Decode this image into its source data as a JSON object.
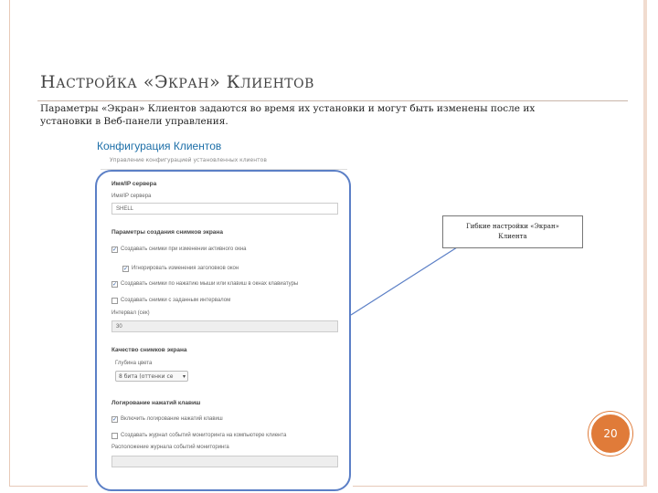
{
  "slide": {
    "title_cap1": "Н",
    "title_rest1": "АСТРОЙКА",
    "title_mid": "«Э",
    "title_mid_rest": "КРАН",
    "title_mid_end": "» К",
    "title_end": "ЛИЕНТОВ",
    "subtitle": "Параметры «Экран» Клиентов задаются во время их установки и могут быть изменены после их установки в Веб-панели управления.",
    "page_number": "20"
  },
  "panel": {
    "title": "Конфигурация Клиентов",
    "description": "Управление конфигурацией установленных клиентов",
    "server_section": "Имя/IP сервера",
    "server_label": "Имя/IP сервера",
    "server_value": "SHELL",
    "capture_section": "Параметры создания снимков экрана",
    "opt_change_window": "Создавать снимки при изменении активного окна",
    "opt_ignore_same": "Игнорировать изменения заголовков окон",
    "opt_mouse_click": "Создавать снимки по нажатию мыши или клавиш в окнах клавиатуры",
    "opt_interval": "Создавать снимки с заданным интервалом",
    "interval_label": "Интервал (сек)",
    "interval_value": "30",
    "quality_section": "Качество снимков экрана",
    "quality_label": "Глубина цвета",
    "quality_value": "8 бита (оттенки се",
    "log_section": "Логирование нажатий клавиш",
    "opt_log_keys": "Включить логирование нажатий клавиш",
    "opt_local_log": "Создавать журнал событий мониторинга на компьютере клиента",
    "log_path_label": "Расположение журнала событий мониторинга",
    "log_path_value": ""
  },
  "callout": {
    "line1": "Гибкие настройки «Экран»",
    "line2": "Клиента"
  },
  "colors": {
    "accent": "#e07b39",
    "highlight": "#5b7fc6",
    "panel_title": "#1d6fa8",
    "frame": "#e7c9b8"
  }
}
